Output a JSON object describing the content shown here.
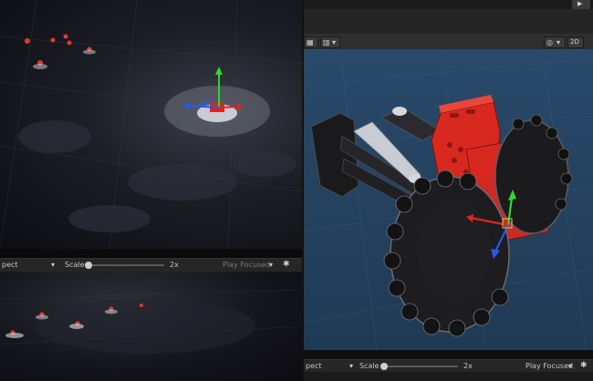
{
  "game_view_top": {
    "label_aspect": "pect",
    "scale_label": "Scale",
    "scale_value": "2x",
    "play_focused": "Play Focused",
    "scale_fraction": 0.1
  },
  "game_view_bottom_left": {
    "label_aspect": "pect",
    "scale_label": "Scale",
    "scale_value": "2x",
    "play_focused": "Play Focused",
    "scale_fraction": 0.1
  },
  "scene_toolbar": {
    "mode_2d": "2D",
    "play_icon": "play-icon",
    "gizmo_icon": "gizmo-icon"
  },
  "icons": {
    "bug": "bug-icon",
    "dropdown": "chevron-down-icon"
  },
  "colors": {
    "scene_bg": "#24405d",
    "robot_red": "#d8281f",
    "gizmo_x": "#e0261e",
    "gizmo_y": "#32d62e",
    "gizmo_z": "#2a59e8"
  }
}
